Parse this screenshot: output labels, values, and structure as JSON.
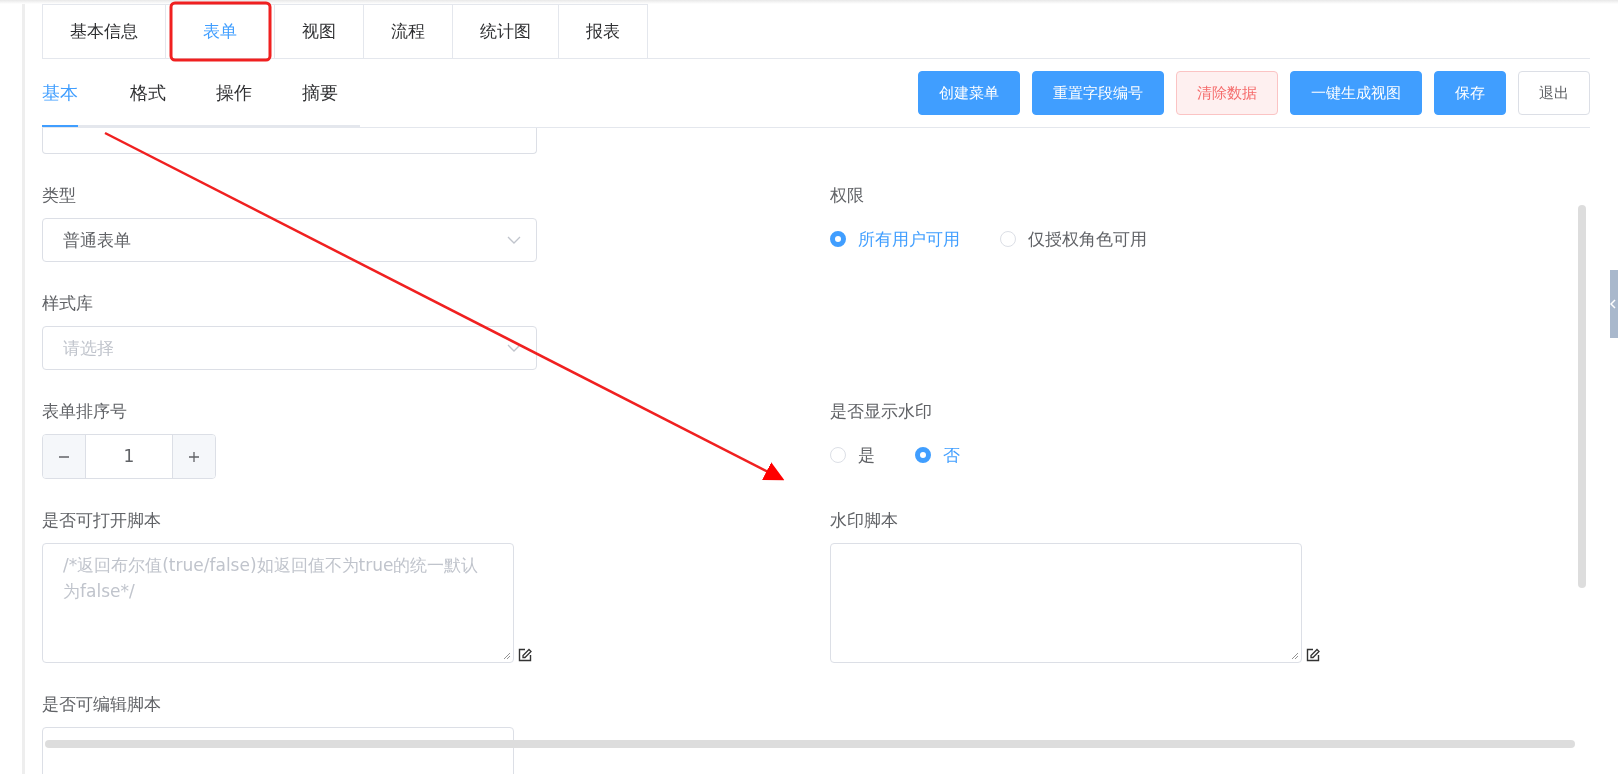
{
  "top_tabs": [
    {
      "label": "基本信息",
      "selected": false
    },
    {
      "label": "表单",
      "selected": true
    },
    {
      "label": "视图",
      "selected": false
    },
    {
      "label": "流程",
      "selected": false
    },
    {
      "label": "统计图",
      "selected": false
    },
    {
      "label": "报表",
      "selected": false
    }
  ],
  "sub_tabs": [
    {
      "label": "基本",
      "selected": true
    },
    {
      "label": "格式",
      "selected": false
    },
    {
      "label": "操作",
      "selected": false
    },
    {
      "label": "摘要",
      "selected": false
    }
  ],
  "toolbar": [
    {
      "label": "创建菜单",
      "kind": "primary"
    },
    {
      "label": "重置字段编号",
      "kind": "primary"
    },
    {
      "label": "清除数据",
      "kind": "danger"
    },
    {
      "label": "一键生成视图",
      "kind": "primary"
    },
    {
      "label": "保存",
      "kind": "primary"
    },
    {
      "label": "退出",
      "kind": "plain"
    }
  ],
  "form_rows": [
    {
      "left": {
        "label": "类型",
        "kind": "select",
        "value": "普通表单"
      },
      "right": {
        "label": "权限",
        "kind": "radio",
        "options": [
          {
            "label": "所有用户可用",
            "selected": true
          },
          {
            "label": "仅授权角色可用",
            "selected": false
          }
        ]
      }
    },
    {
      "left": {
        "label": "样式库",
        "kind": "select",
        "placeholder": "请选择"
      }
    },
    {
      "left": {
        "label": "表单排序号",
        "kind": "number",
        "value": "1"
      },
      "right": {
        "label": "是否显示水印",
        "kind": "radio",
        "options": [
          {
            "label": "是",
            "selected": false
          },
          {
            "label": "否",
            "selected": true
          }
        ]
      }
    },
    {
      "left": {
        "label": "是否可打开脚本",
        "kind": "textarea",
        "placeholder": "/*返回布尔值(true/false)如返回值不为true的统一默认为false*/"
      },
      "right": {
        "label": "水印脚本",
        "kind": "textarea"
      }
    },
    {
      "left": {
        "label": "是否可编辑脚本",
        "kind": "textarea"
      }
    }
  ],
  "annotations": {
    "tab_highlight": true,
    "arrow": true
  }
}
